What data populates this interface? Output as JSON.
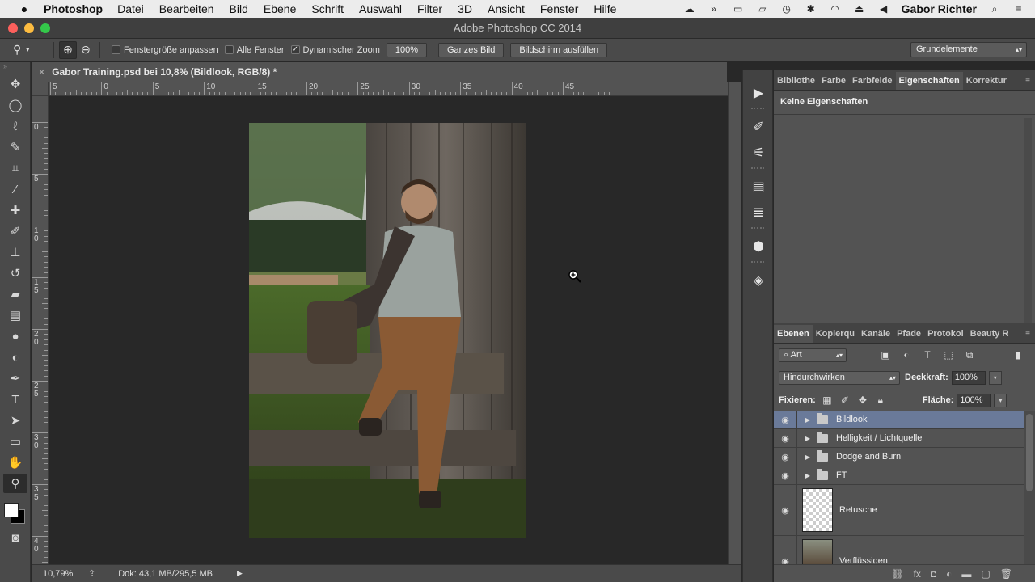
{
  "menubar": {
    "app": "Photoshop",
    "items": [
      "Datei",
      "Bearbeiten",
      "Bild",
      "Ebene",
      "Schrift",
      "Auswahl",
      "Filter",
      "3D",
      "Ansicht",
      "Fenster",
      "Hilfe"
    ],
    "user": "Gabor Richter",
    "status_icons": [
      "creative-cloud-icon",
      "fast-forward-icon",
      "screen-icon",
      "airplay-icon",
      "time-machine-icon",
      "bluetooth-icon",
      "wifi-icon",
      "eject-icon",
      "volume-icon"
    ]
  },
  "window": {
    "title": "Adobe Photoshop CC 2014"
  },
  "options": {
    "fit_window": "Fenstergröße anpassen",
    "fit_window_checked": false,
    "all_windows": "Alle Fenster",
    "all_windows_checked": false,
    "scrubby_zoom": "Dynamischer Zoom",
    "scrubby_zoom_checked": true,
    "btn_100": "100%",
    "btn_fit": "Ganzes Bild",
    "btn_fill": "Bildschirm ausfüllen",
    "workspace": "Grundelemente"
  },
  "document": {
    "tab_title": "Gabor Training.psd bei 10,8% (Bildlook, RGB/8) *",
    "ruler_h": [
      "5",
      "0",
      "5",
      "10",
      "15",
      "20",
      "25",
      "30",
      "35",
      "40",
      "45"
    ],
    "ruler_v": [
      "0",
      "5",
      "1\n0",
      "1\n5",
      "2\n0",
      "2\n5",
      "3\n0",
      "3\n5",
      "4\n0"
    ]
  },
  "status": {
    "zoom": "10,79%",
    "doc": "Dok: 43,1 MB/295,5 MB"
  },
  "properties_panel": {
    "tabs": [
      "Bibliothe",
      "Farbe",
      "Farbfelde",
      "Eigenschaften",
      "Korrektur"
    ],
    "active_tab": "Eigenschaften",
    "body": "Keine Eigenschaften"
  },
  "layers_panel": {
    "tabs": [
      "Ebenen",
      "Kopierqu",
      "Kanäle",
      "Pfade",
      "Protokol",
      "Beauty R"
    ],
    "active_tab": "Ebenen",
    "filter": "Art",
    "blend_mode": "Hindurchwirken",
    "opacity_label": "Deckkraft:",
    "opacity": "100%",
    "lock_label": "Fixieren:",
    "fill_label": "Fläche:",
    "fill": "100%",
    "layers": [
      {
        "name": "Bildlook",
        "type": "group",
        "selected": true
      },
      {
        "name": "Helligkeit / Lichtquelle",
        "type": "group",
        "selected": false
      },
      {
        "name": "Dodge and Burn",
        "type": "group",
        "selected": false
      },
      {
        "name": "FT",
        "type": "group",
        "selected": false
      },
      {
        "name": "Retusche",
        "type": "pixel",
        "selected": false
      },
      {
        "name": "Verflüssigen",
        "type": "pixel",
        "selected": false
      }
    ]
  },
  "colors": {
    "selected_layer": "#6a7a99",
    "panel_bg": "#535353",
    "canvas_bg": "#282828"
  }
}
